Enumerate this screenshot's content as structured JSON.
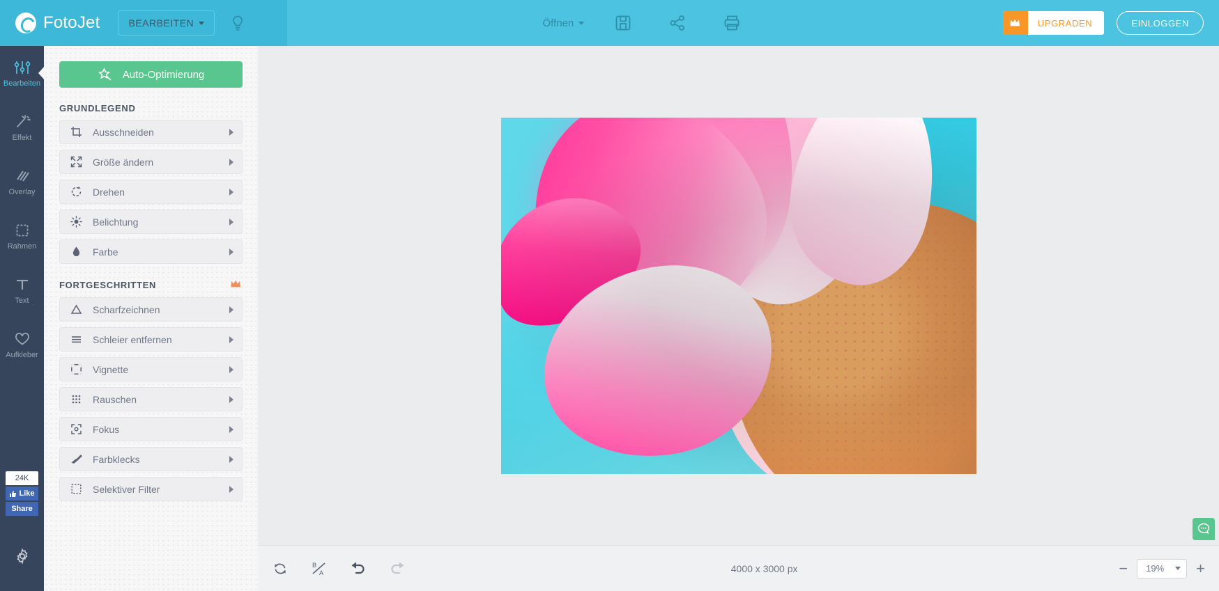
{
  "app": {
    "brand": "FotoJet",
    "accent_blue": "#4cc3e0",
    "accent_green": "#5ac68f",
    "accent_orange": "#f89728",
    "rail_bg": "#36455b"
  },
  "header": {
    "edit_menu_label": "BEARBEITEN",
    "bulb_icon": "lightbulb-icon",
    "open_label": "Öffnen",
    "icons": [
      {
        "name": "save-icon",
        "label": "save"
      },
      {
        "name": "share-icon",
        "label": "share"
      },
      {
        "name": "print-icon",
        "label": "print"
      }
    ],
    "upgrade_label": "UPGRADEN",
    "upgrade_icon": "crown-icon",
    "login_label": "EINLOGGEN"
  },
  "rail": {
    "items": [
      {
        "label": "Bearbeiten",
        "icon": "sliders-icon",
        "active": true
      },
      {
        "label": "Effekt",
        "icon": "magic-wand-icon",
        "active": false
      },
      {
        "label": "Overlay",
        "icon": "hatch-square-icon",
        "active": false
      },
      {
        "label": "Rahmen",
        "icon": "frame-icon",
        "active": false
      },
      {
        "label": "Text",
        "icon": "text-t-icon",
        "active": false
      },
      {
        "label": "Aufkleber",
        "icon": "heart-icon",
        "active": false
      }
    ],
    "facebook": {
      "count": "24K",
      "like_label": "Like",
      "share_label": "Share",
      "brand_color": "#4267b2"
    },
    "settings_icon": "gear-icon"
  },
  "panel": {
    "auto_button": {
      "label": "Auto-Optimierung",
      "icon": "magic-wand-icon"
    },
    "sections": [
      {
        "title": "GRUNDLEGEND",
        "premium": false,
        "items": [
          {
            "label": "Ausschneiden",
            "icon": "crop-icon"
          },
          {
            "label": "Größe ändern",
            "icon": "resize-icon"
          },
          {
            "label": "Drehen",
            "icon": "rotate-icon"
          },
          {
            "label": "Belichtung",
            "icon": "brightness-icon"
          },
          {
            "label": "Farbe",
            "icon": "droplet-icon"
          }
        ]
      },
      {
        "title": "FORTGESCHRITTEN",
        "premium": true,
        "premium_icon": "crown-icon",
        "items": [
          {
            "label": "Scharfzeichnen",
            "icon": "triangle-icon"
          },
          {
            "label": "Schleier entfernen",
            "icon": "lines-icon"
          },
          {
            "label": "Vignette",
            "icon": "vignette-icon"
          },
          {
            "label": "Rauschen",
            "icon": "noise-grid-icon"
          },
          {
            "label": "Fokus",
            "icon": "focus-icon"
          },
          {
            "label": "Farbklecks",
            "icon": "paintbrush-icon"
          },
          {
            "label": "Selektiver Filter",
            "icon": "dotted-square-icon"
          }
        ]
      }
    ]
  },
  "canvas": {
    "image_alt": "pink-daisy-flower-closeup"
  },
  "bottombar": {
    "buttons": [
      {
        "name": "reset-button",
        "icon": "reset-icon",
        "disabled": false
      },
      {
        "name": "before-after-button",
        "icon": "before-after-icon",
        "disabled": false
      },
      {
        "name": "undo-button",
        "icon": "undo-icon",
        "disabled": false
      },
      {
        "name": "redo-button",
        "icon": "redo-icon",
        "disabled": true
      }
    ],
    "dimensions": "4000 x 3000 px",
    "zoom_minus": "−",
    "zoom_value": "19%",
    "zoom_plus": "+"
  },
  "chat": {
    "icon": "chat-bubble-icon"
  }
}
